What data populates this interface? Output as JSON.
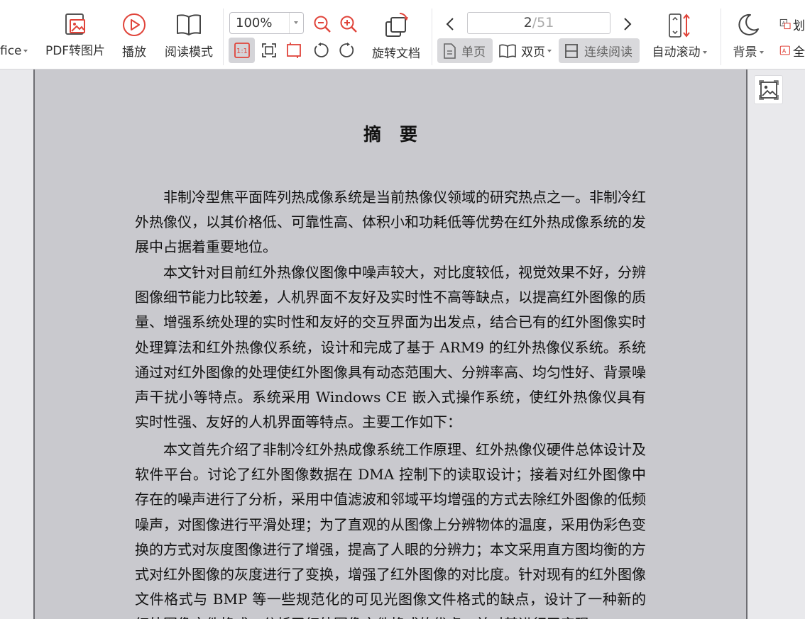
{
  "toolbar": {
    "office_label": "fice",
    "pdf_to_image_label": "PDF转图片",
    "play_label": "播放",
    "read_mode_label": "阅读模式",
    "zoom_value": "100%",
    "rotate_doc_label": "旋转文档",
    "page_current": "2",
    "page_total": "/51",
    "single_page_label": "单页",
    "double_page_label": "双页",
    "continuous_label": "连续阅读",
    "auto_scroll_label": "自动滚动",
    "background_label": "背景",
    "right_edge_text_1": "划",
    "right_edge_text_2": "全"
  },
  "document": {
    "title": "摘要",
    "paragraphs": [
      "非制冷型焦平面阵列热成像系统是当前热像仪领域的研究热点之一。非制冷红外热像仪，以其价格低、可靠性高、体积小和功耗低等优势在红外热成像系统的发展中占据着重要地位。",
      "本文针对目前红外热像仪图像中噪声较大，对比度较低，视觉效果不好，分辨图像细节能力比较差，人机界面不友好及实时性不高等缺点，以提高红外图像的质量、增强系统处理的实时性和友好的交互界面为出发点，结合已有的红外图像实时处理算法和红外热像仪系统，设计和完成了基于 ARM9 的红外热像仪系统。系统通过对红外图像的处理使红外图像具有动态范围大、分辨率高、均匀性好、背景噪声干扰小等特点。系统采用 Windows CE 嵌入式操作系统，使红外热像仪具有实时性强、友好的人机界面等特点。主要工作如下：",
      "本文首先介绍了非制冷红外热成像系统工作原理、红外热像仪硬件总体设计及软件平台。讨论了红外图像数据在 DMA 控制下的读取设计；接着对红外图像中存在的噪声进行了分析，采用中值滤波和邻域平均增强的方式去除红外图像的低频噪声，对图像进行平滑处理；为了直观的从图像上分辨物体的温度，采用伪彩色变换的方式对灰度图像进行了增强，提高了人眼的分辨力；本文采用直方图均衡的方式对红外图像的灰度进行了变换，增强了红外图像的对比度。针对现有的红外图像文件格式与 BMP 等一些规范化的可见光图像文件格式的缺点，设计了一种新的红外图像文件格式，分析了红外图像文件格式的优点，并对其进行了实现。"
    ]
  },
  "colors": {
    "page_bg": "#c9c9ce",
    "toolbar_bg": "#ffffff",
    "icon_red": "#e0443a",
    "icon_gray": "#444444"
  }
}
